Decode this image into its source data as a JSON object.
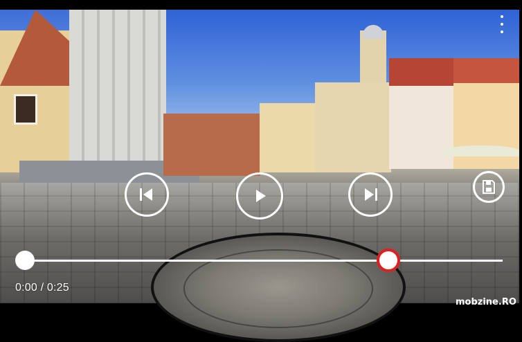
{
  "video": {
    "description_hidden": "",
    "current_time": "0:00",
    "separator": " / ",
    "duration": "0:25",
    "progress": 0.0
  },
  "controls": {
    "previous_icon": "skip-previous-icon",
    "play_icon": "play-icon",
    "next_icon": "skip-next-icon",
    "save_icon": "save-icon",
    "menu_icon": "more-vertical-icon"
  },
  "watermark": "mobzine.RO",
  "colors": {
    "accent": "#e02020",
    "control_white": "#ffffff"
  }
}
